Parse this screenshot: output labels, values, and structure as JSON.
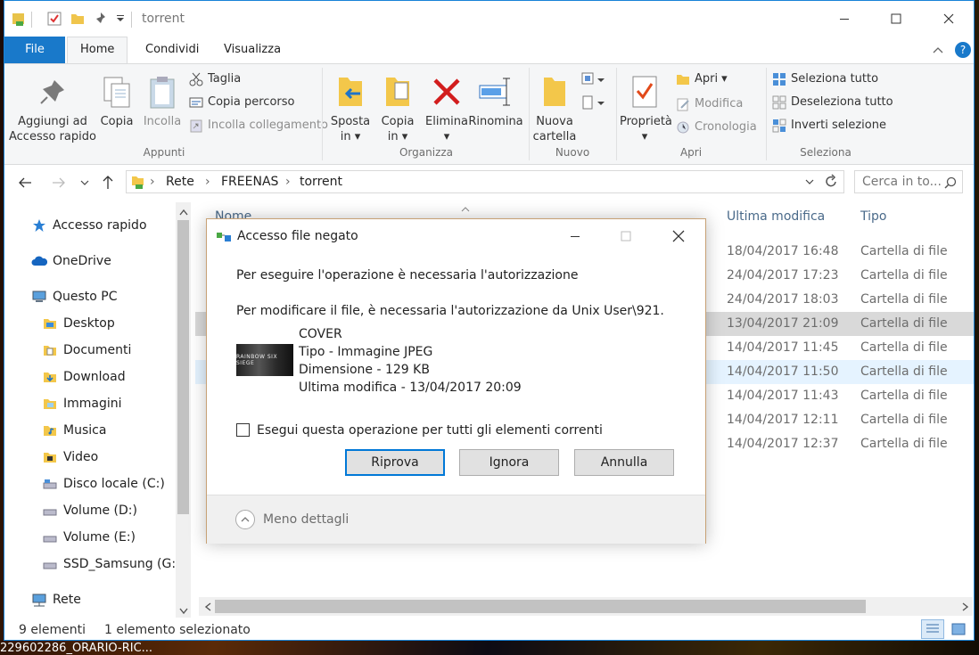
{
  "window": {
    "title": "torrent"
  },
  "tabs": {
    "file": "File",
    "home": "Home",
    "share": "Condividi",
    "view": "Visualizza"
  },
  "ribbon": {
    "clipboard": {
      "pin_line1": "Aggiungi ad",
      "pin_line2": "Accesso rapido",
      "copy": "Copia",
      "paste": "Incolla",
      "cut": "Taglia",
      "copy_path": "Copia percorso",
      "paste_shortcut": "Incolla collegamento",
      "label": "Appunti"
    },
    "organize": {
      "move_line1": "Sposta",
      "move_line2": "in",
      "copyto_line1": "Copia",
      "copyto_line2": "in",
      "delete": "Elimina",
      "rename": "Rinomina",
      "label": "Organizza"
    },
    "new": {
      "folder_line1": "Nuova",
      "folder_line2": "cartella",
      "label": "Nuovo"
    },
    "open": {
      "properties": "Proprietà",
      "open": "Apri",
      "edit": "Modifica",
      "history": "Cronologia",
      "label": "Apri"
    },
    "select": {
      "all": "Seleziona tutto",
      "none": "Deseleziona tutto",
      "invert": "Inverti selezione",
      "label": "Seleziona"
    }
  },
  "address": {
    "crumbs": [
      "Rete",
      "FREENAS",
      "torrent"
    ],
    "search_placeholder": "Cerca in to..."
  },
  "nav": {
    "quick": "Accesso rapido",
    "onedrive": "OneDrive",
    "pc": "Questo PC",
    "desktop": "Desktop",
    "documents": "Documenti",
    "downloads": "Download",
    "pictures": "Immagini",
    "music": "Musica",
    "videos": "Video",
    "c": "Disco locale (C:)",
    "d": "Volume (D:)",
    "e": "Volume (E:)",
    "g": "SSD_Samsung (G:)",
    "network": "Rete"
  },
  "columns": {
    "name": "Nome",
    "modified": "Ultima modifica",
    "type": "Tipo"
  },
  "rows": [
    {
      "date": "18/04/2017 16:48",
      "type": "Cartella di file"
    },
    {
      "date": "24/04/2017 17:23",
      "type": "Cartella di file"
    },
    {
      "date": "24/04/2017 18:03",
      "type": "Cartella di file"
    },
    {
      "date": "13/04/2017 21:09",
      "type": "Cartella di file"
    },
    {
      "date": "14/04/2017 11:45",
      "type": "Cartella di file"
    },
    {
      "date": "14/04/2017 11:50",
      "type": "Cartella di file"
    },
    {
      "date": "14/04/2017 11:43",
      "type": "Cartella di file"
    },
    {
      "date": "14/04/2017 12:11",
      "type": "Cartella di file"
    },
    {
      "date": "14/04/2017 12:37",
      "type": "Cartella di file"
    }
  ],
  "status": {
    "count": "9 elementi",
    "selected": "1 elemento selezionato"
  },
  "dialog": {
    "title": "Accesso file negato",
    "message1": "Per eseguire l'operazione è necessaria l'autorizzazione",
    "message2": "Per modificare il file, è necessaria l'autorizzazione da Unix User\\921.",
    "file_name": "COVER",
    "file_type": "Tipo - Immagine JPEG",
    "file_size": "Dimensione - 129 KB",
    "file_modified": "Ultima modifica - 13/04/2017 20:09",
    "thumb_text": "RAINBOW SIX SIEGE",
    "checkbox": "Esegui questa operazione per tutti gli elementi correnti",
    "retry": "Riprova",
    "ignore": "Ignora",
    "cancel": "Annulla",
    "less_details": "Meno dettagli"
  },
  "taskbar_text": "229602286_ORARIO-RIC...",
  "colors": {
    "accent": "#1979ca",
    "selection": "#d9d9d9",
    "hover": "#e5f3ff",
    "dialog_border": "#c7a175"
  }
}
